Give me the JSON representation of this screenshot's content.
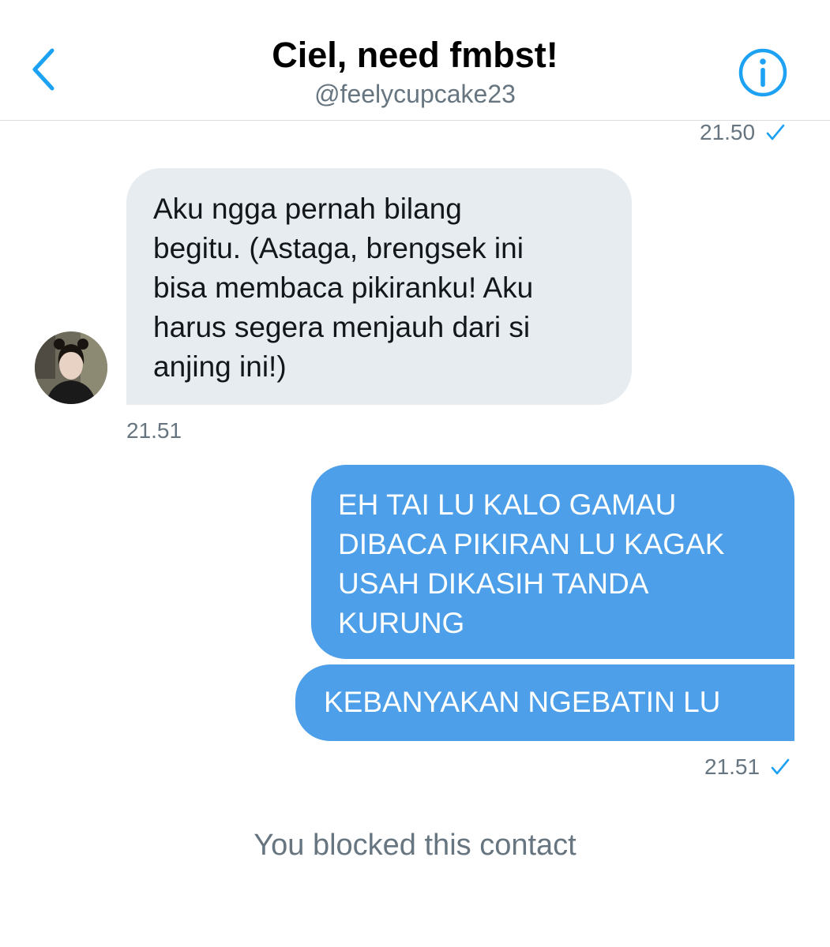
{
  "header": {
    "title": "Ciel, need fmbst!",
    "handle": "@feelycupcake23",
    "back_icon": "chevron-left-icon",
    "info_icon": "info-circle-icon"
  },
  "messages": [
    {
      "direction": "sent",
      "timestamp": "21.50",
      "status": "sent-check"
    },
    {
      "direction": "received",
      "lines": [
        "Aku ngga pernah bilang",
        "begitu. (Astaga, brengsek ini",
        "bisa membaca pikiranku! Aku",
        "harus segera menjauh dari si",
        "anjing ini!)"
      ],
      "timestamp": "21.51"
    },
    {
      "direction": "sent",
      "lines": [
        "EH TAI LU KALO GAMAU",
        "DIBACA PIKIRAN LU KAGAK",
        "USAH DIKASIH TANDA",
        "KURUNG"
      ]
    },
    {
      "direction": "sent",
      "lines": [
        "KEBANYAKAN NGEBATIN LU"
      ],
      "timestamp": "21.51",
      "status": "sent-check"
    }
  ],
  "footer": {
    "blocked_text": "You blocked this contact"
  },
  "colors": {
    "accent": "#1da1f2",
    "sent_bubble": "#4c9fe8",
    "received_bubble": "#e6ecf0",
    "muted_text": "#66757f"
  }
}
